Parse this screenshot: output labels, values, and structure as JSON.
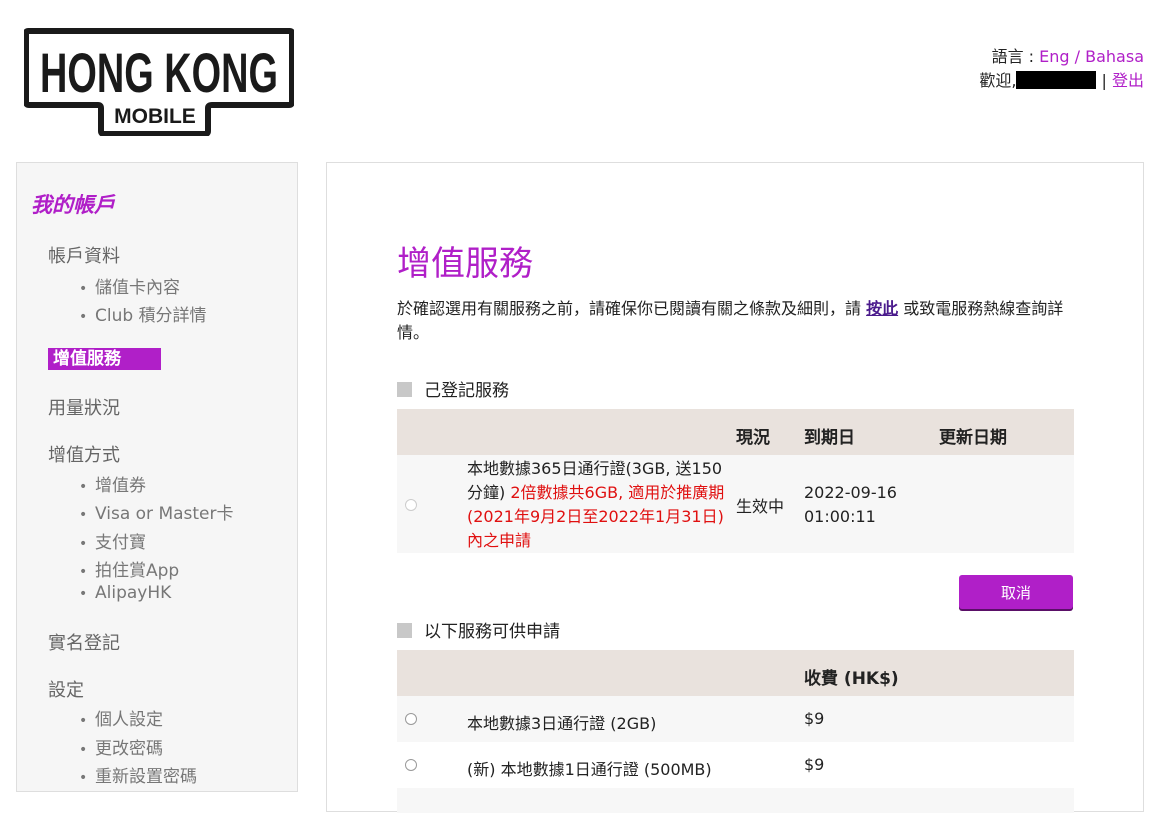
{
  "logo": {
    "line1": "HONG KONG",
    "line2": "MOBILE"
  },
  "header": {
    "lang_label": "語言 : ",
    "lang_eng": "Eng",
    "lang_sep": " / ",
    "lang_bahasa": "Bahasa",
    "welcome": "歡迎,",
    "separator": " | ",
    "logout": "登出"
  },
  "sidebar": {
    "title": "我的帳戶",
    "account_info": "帳戶資料",
    "account_sub": [
      "儲值卡內容",
      "Club 積分詳情"
    ],
    "active": "增值服務",
    "usage": "用量狀況",
    "topup": "增值方式",
    "topup_sub": [
      "增值券",
      "Visa or Master卡",
      "支付寶",
      "拍住賞App",
      "AlipayHK"
    ],
    "realname": "實名登記",
    "settings": "設定",
    "settings_sub": [
      "個人設定",
      "更改密碼",
      "重新設置密碼"
    ]
  },
  "main": {
    "title": "增值服務",
    "intro_before": "於確認選用有關服務之前，請確保你已閱讀有關之條款及細則，請 ",
    "intro_link": "按此",
    "intro_after": " 或致電服務熱線查詢詳情。",
    "registered_label": "己登記服務",
    "registered_headers": {
      "status": "現況",
      "expiry": "到期日",
      "renewal": "更新日期"
    },
    "registered_row": {
      "name": "本地數據365日通行證(3GB, 送150分鐘) ",
      "promo": "2倍數據共6GB, 適用於推廣期(2021年9月2日至2022年1月31日)內之申請",
      "status": "生效中",
      "expiry_date": "2022-09-16",
      "expiry_time": "01:00:11",
      "renewal": ""
    },
    "cancel_button": "取消",
    "available_label": "以下服務可供申請",
    "available_headers": {
      "fee": "收費 (HK$)"
    },
    "available_rows": [
      {
        "name": "本地數據3日通行證 (2GB)",
        "fee": "$9"
      },
      {
        "name": "(新) 本地數據1日通行證 (500MB)",
        "fee": "$9"
      }
    ]
  },
  "colors": {
    "accent": "#b01fc8",
    "promo_red": "#e01010",
    "header_bg": "#e9e2dd"
  }
}
